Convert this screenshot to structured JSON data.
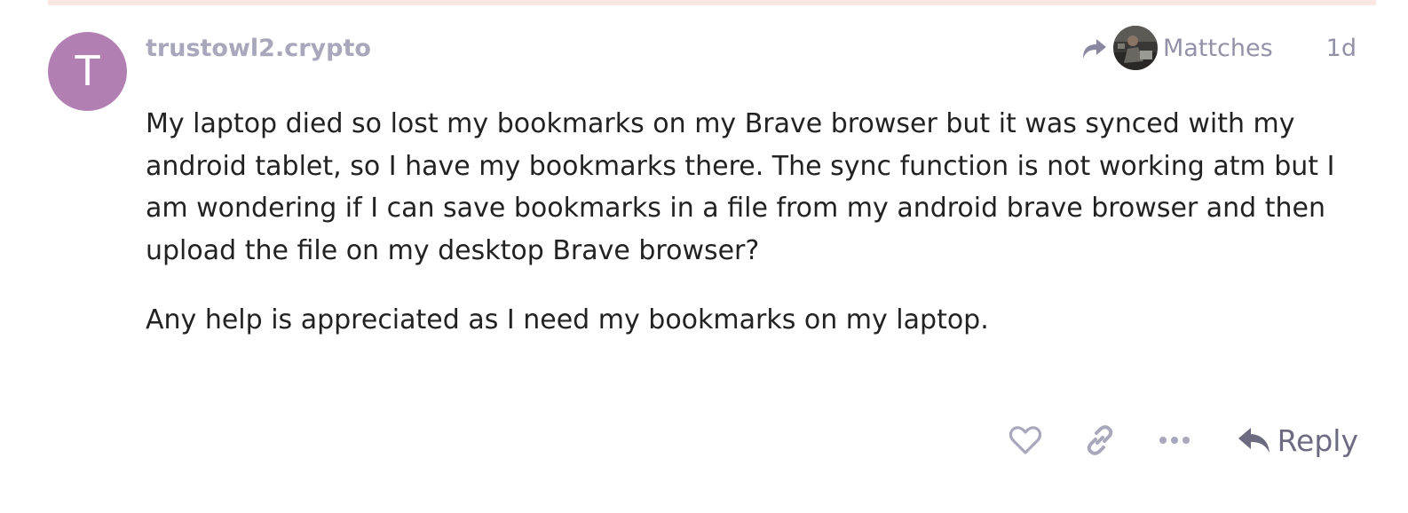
{
  "post": {
    "author_initial": "T",
    "username": "trustowl2.crypto",
    "reply_to_name": "Mattches",
    "date": "1d",
    "paragraphs": [
      "My laptop died so lost my bookmarks on my Brave browser but it was synced with my android tablet, so I have my bookmarks there. The sync function is not working atm but I am wondering if I can save bookmarks in a file from my android brave browser and then upload the file on my desktop Brave browser?",
      "Any help is appreciated as I need my bookmarks on my laptop."
    ]
  },
  "actions": {
    "reply_label": "Reply"
  },
  "icons": {
    "reply_to": "share-arrow-icon",
    "like": "heart-icon",
    "copy_link": "link-icon",
    "more": "ellipsis-icon",
    "reply": "reply-arrow-icon"
  },
  "colors": {
    "avatar_bg": "#b27fb2",
    "muted_text": "#9391a8",
    "username_text": "#a8a7bb",
    "icon_gray": "#a8a7bb",
    "reply_text": "#6d6b82",
    "top_strip": "#fbe8e4"
  }
}
